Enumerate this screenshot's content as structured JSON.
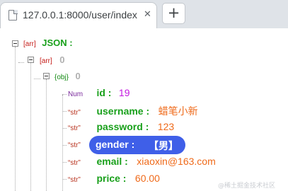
{
  "browser": {
    "tab_title": "127.0.0.1:8000/user/index",
    "close_glyph": "✕",
    "new_tab_glyph": "+",
    "icons": [
      "page-icon",
      "close-icon",
      "plus-icon"
    ]
  },
  "json_view": {
    "root": {
      "type_tag": "[arr]",
      "key": "JSON :"
    },
    "level1": {
      "type_tag": "[arr]",
      "index": "0"
    },
    "level2": {
      "type_tag": "{obj}",
      "index": "0"
    },
    "fields": [
      {
        "type_tag": "Num",
        "key": "id :",
        "value": "19"
      },
      {
        "type_tag": "“str”",
        "key": "username :",
        "value": "蜡笔小新"
      },
      {
        "type_tag": "“str”",
        "key": "password :",
        "value": "123"
      },
      {
        "type_tag": "“str”",
        "key": "gender :",
        "value": "【男】",
        "selected": true
      },
      {
        "type_tag": "“str”",
        "key": "email :",
        "value": "xiaoxin@163.com"
      },
      {
        "type_tag": "“str”",
        "key": "price :",
        "value": "60.00"
      }
    ],
    "colors": {
      "key": "#19a01b",
      "string_value": "#ef6a1a",
      "number_value": "#c41ae0",
      "selection": "#3f5fe8"
    }
  },
  "watermark": "@稀土掘金技术社区"
}
